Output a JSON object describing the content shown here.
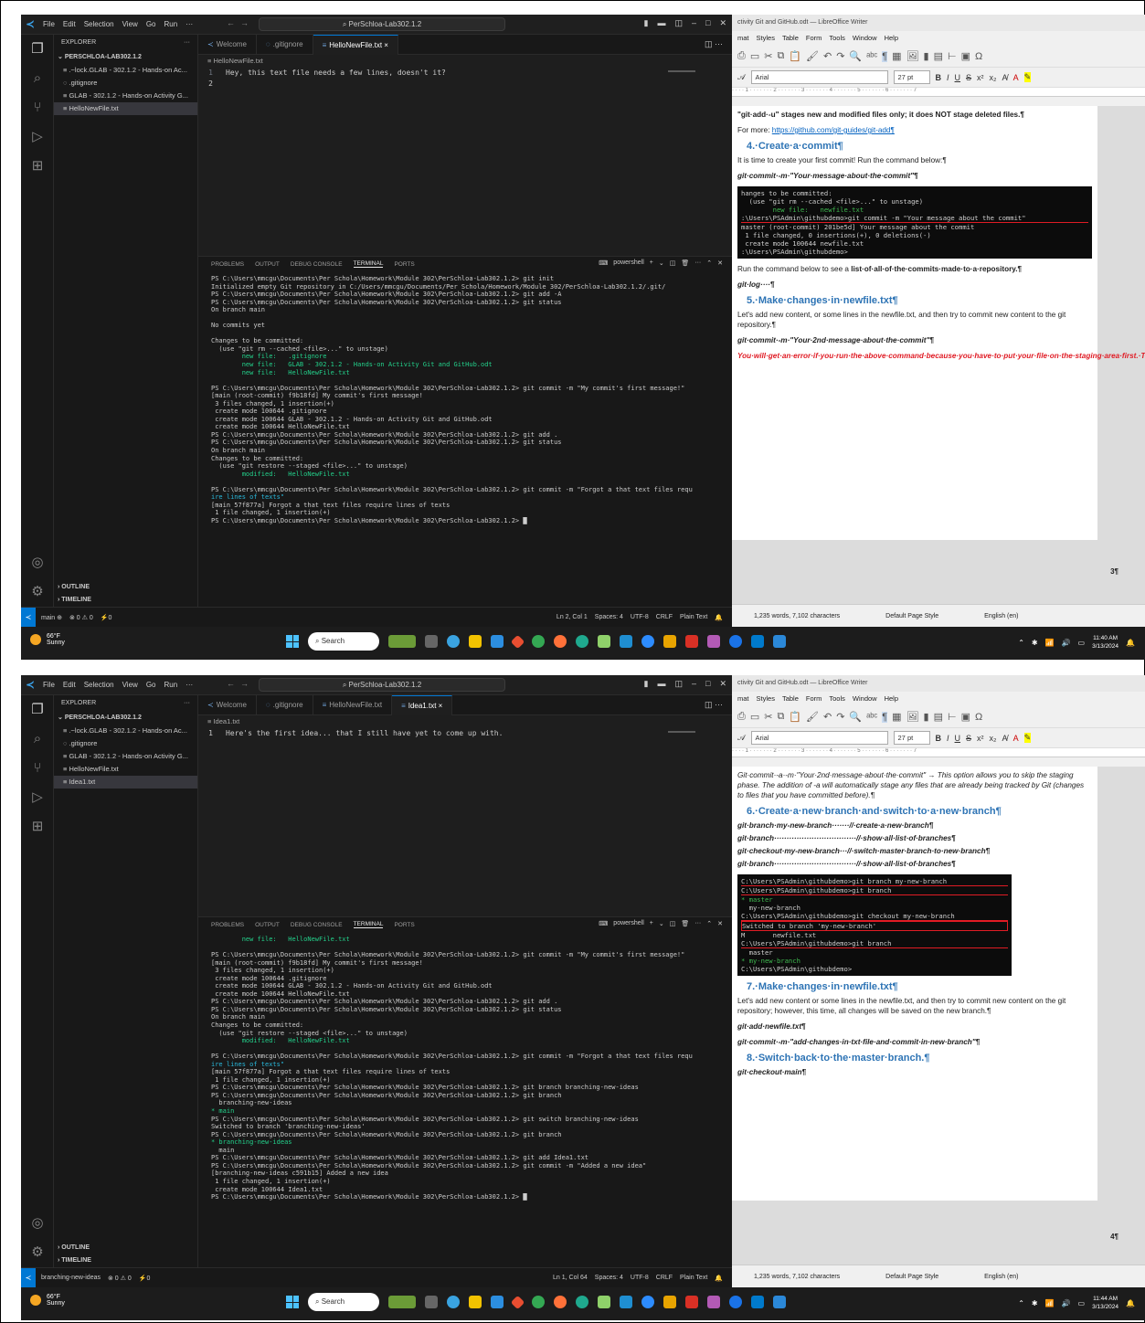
{
  "screens": [
    {
      "vscode": {
        "menu": [
          "File",
          "Edit",
          "Selection",
          "View",
          "Go",
          "Run",
          "···"
        ],
        "command_center": "PerSchloa-Lab302.1.2",
        "explorer_label": "EXPLORER",
        "root_folder": "PERSCHLOA-LAB302.1.2",
        "files": [
          ".~lock.GLAB - 302.1.2 - Hands-on Ac...",
          ".gitignore",
          "GLAB - 302.1.2 - Hands-on Activity G...",
          "HelloNewFile.txt"
        ],
        "selected_file_index": 3,
        "tabs": [
          {
            "label": "Welcome",
            "icon": "vscode-icon"
          },
          {
            "label": ".gitignore",
            "icon": "gear-icon"
          },
          {
            "label": "HelloNewFile.txt ×",
            "icon": "text-file-icon"
          }
        ],
        "active_tab_index": 2,
        "breadcrumb": "HelloNewFile.txt",
        "editor_lines": [
          "Hey, this text file needs a few lines, doesn't it?",
          ""
        ],
        "panel_tabs": [
          "PROBLEMS",
          "OUTPUT",
          "DEBUG CONSOLE",
          "TERMINAL",
          "PORTS"
        ],
        "terminal_name": "powershell",
        "terminal_lines": [
          {
            "t": "PS C:\\Users\\mmcgu\\Documents\\Per Schola\\Homework\\Module 302\\PerSchloa-Lab302.1.2> git init",
            "s": ""
          },
          {
            "t": "Initialized empty Git repository in C:/Users/mmcgu/Documents/Per Schola/Homework/Module 302/PerSchloa-Lab302.1.2/.git/",
            "s": ""
          },
          {
            "t": "PS C:\\Users\\mmcgu\\Documents\\Per Schola\\Homework\\Module 302\\PerSchloa-Lab302.1.2> git add -A",
            "s": ""
          },
          {
            "t": "PS C:\\Users\\mmcgu\\Documents\\Per Schola\\Homework\\Module 302\\PerSchloa-Lab302.1.2> git status",
            "s": ""
          },
          {
            "t": "On branch main",
            "s": ""
          },
          {
            "t": "",
            "s": ""
          },
          {
            "t": "No commits yet",
            "s": ""
          },
          {
            "t": "",
            "s": ""
          },
          {
            "t": "Changes to be committed:",
            "s": ""
          },
          {
            "t": "  (use \"git rm --cached <file>...\" to unstage)",
            "s": ""
          },
          {
            "t": "        new file:   .gitignore",
            "s": "g"
          },
          {
            "t": "        new file:   GLAB - 302.1.2 - Hands-on Activity Git and GitHub.odt",
            "s": "g"
          },
          {
            "t": "        new file:   HelloNewFile.txt",
            "s": "g"
          },
          {
            "t": "",
            "s": ""
          },
          {
            "t": "PS C:\\Users\\mmcgu\\Documents\\Per Schola\\Homework\\Module 302\\PerSchloa-Lab302.1.2> git commit -m \"My commit's first message!\"",
            "s": ""
          },
          {
            "t": "[main (root-commit) f9b18fd] My commit's first message!",
            "s": ""
          },
          {
            "t": " 3 files changed, 1 insertion(+)",
            "s": ""
          },
          {
            "t": " create mode 100644 .gitignore",
            "s": ""
          },
          {
            "t": " create mode 100644 GLAB - 302.1.2 - Hands-on Activity Git and GitHub.odt",
            "s": ""
          },
          {
            "t": " create mode 100644 HelloNewFile.txt",
            "s": ""
          },
          {
            "t": "PS C:\\Users\\mmcgu\\Documents\\Per Schola\\Homework\\Module 302\\PerSchloa-Lab302.1.2> git add .",
            "s": ""
          },
          {
            "t": "PS C:\\Users\\mmcgu\\Documents\\Per Schola\\Homework\\Module 302\\PerSchloa-Lab302.1.2> git status",
            "s": ""
          },
          {
            "t": "On branch main",
            "s": ""
          },
          {
            "t": "Changes to be committed:",
            "s": ""
          },
          {
            "t": "  (use \"git restore --staged <file>...\" to unstage)",
            "s": ""
          },
          {
            "t": "        modified:   HelloNewFile.txt",
            "s": "g"
          },
          {
            "t": "",
            "s": ""
          },
          {
            "t": "PS C:\\Users\\mmcgu\\Documents\\Per Schola\\Homework\\Module 302\\PerSchloa-Lab302.1.2> git commit -m \"Forgot a that text files requ",
            "s": ""
          },
          {
            "t": "ire lines of texts\"",
            "s": "c"
          },
          {
            "t": "[main 57f877a] Forgot a that text files require lines of texts",
            "s": ""
          },
          {
            "t": " 1 file changed, 1 insertion(+)",
            "s": ""
          },
          {
            "t": "PS C:\\Users\\mmcgu\\Documents\\Per Schola\\Homework\\Module 302\\PerSchloa-Lab302.1.2> █",
            "s": ""
          }
        ],
        "outline": "OUTLINE",
        "timeline": "TIMELINE",
        "status_left": [
          "main ⊕",
          "⊗ 0 ⚠ 0",
          "⚡0"
        ],
        "status_right": [
          "Ln 2, Col 1",
          "Spaces: 4",
          "UTF-8",
          "CRLF",
          "Plain Text"
        ]
      },
      "writer": {
        "title": "ctivity Git and GitHub.odt — LibreOffice Writer",
        "menu": [
          "mat",
          "Styles",
          "Table",
          "Form",
          "Tools",
          "Window",
          "Help"
        ],
        "font": "Arial",
        "size": "27 pt",
        "page_number": "3¶",
        "status": [
          "1,235 words, 7,102 characters",
          "Default Page Style",
          "English (en)"
        ]
      },
      "taskbar": {
        "temp": "66°F",
        "weather": "Sunny",
        "search": "Search",
        "time": "11:40 AM",
        "date": "3/13/2024"
      }
    },
    {
      "vscode": {
        "menu": [
          "File",
          "Edit",
          "Selection",
          "View",
          "Go",
          "Run",
          "···"
        ],
        "command_center": "PerSchloa-Lab302.1.2",
        "explorer_label": "EXPLORER",
        "root_folder": "PERSCHLOA-LAB302.1.2",
        "files": [
          ".~lock.GLAB - 302.1.2 - Hands-on Ac...",
          ".gitignore",
          "GLAB - 302.1.2 - Hands-on Activity G...",
          "HelloNewFile.txt",
          "Idea1.txt"
        ],
        "selected_file_index": 4,
        "tabs": [
          {
            "label": "Welcome",
            "icon": "vscode-icon"
          },
          {
            "label": ".gitignore",
            "icon": "gear-icon"
          },
          {
            "label": "HelloNewFile.txt",
            "icon": "text-file-icon"
          },
          {
            "label": "Idea1.txt ×",
            "icon": "text-file-icon"
          }
        ],
        "active_tab_index": 3,
        "breadcrumb": "Idea1.txt",
        "editor_lines": [
          "Here's the first idea... that I still have yet to come up with."
        ],
        "panel_tabs": [
          "PROBLEMS",
          "OUTPUT",
          "DEBUG CONSOLE",
          "TERMINAL",
          "PORTS"
        ],
        "terminal_name": "powershell",
        "terminal_lines": [
          {
            "t": "        new file:   HelloNewFile.txt",
            "s": "g"
          },
          {
            "t": "",
            "s": ""
          },
          {
            "t": "PS C:\\Users\\mmcgu\\Documents\\Per Schola\\Homework\\Module 302\\PerSchloa-Lab302.1.2> git commit -m \"My commit's first message!\"",
            "s": ""
          },
          {
            "t": "[main (root-commit) f9b18fd] My commit's first message!",
            "s": ""
          },
          {
            "t": " 3 files changed, 1 insertion(+)",
            "s": ""
          },
          {
            "t": " create mode 100644 .gitignore",
            "s": ""
          },
          {
            "t": " create mode 100644 GLAB - 302.1.2 - Hands-on Activity Git and GitHub.odt",
            "s": ""
          },
          {
            "t": " create mode 100644 HelloNewFile.txt",
            "s": ""
          },
          {
            "t": "PS C:\\Users\\mmcgu\\Documents\\Per Schola\\Homework\\Module 302\\PerSchloa-Lab302.1.2> git add .",
            "s": ""
          },
          {
            "t": "PS C:\\Users\\mmcgu\\Documents\\Per Schola\\Homework\\Module 302\\PerSchloa-Lab302.1.2> git status",
            "s": ""
          },
          {
            "t": "On branch main",
            "s": ""
          },
          {
            "t": "Changes to be committed:",
            "s": ""
          },
          {
            "t": "  (use \"git restore --staged <file>...\" to unstage)",
            "s": ""
          },
          {
            "t": "        modified:   HelloNewFile.txt",
            "s": "g"
          },
          {
            "t": "",
            "s": ""
          },
          {
            "t": "PS C:\\Users\\mmcgu\\Documents\\Per Schola\\Homework\\Module 302\\PerSchloa-Lab302.1.2> git commit -m \"Forgot a that text files requ",
            "s": ""
          },
          {
            "t": "ire lines of texts\"",
            "s": "c"
          },
          {
            "t": "[main 57f877a] Forgot a that text files require lines of texts",
            "s": ""
          },
          {
            "t": " 1 file changed, 1 insertion(+)",
            "s": ""
          },
          {
            "t": "PS C:\\Users\\mmcgu\\Documents\\Per Schola\\Homework\\Module 302\\PerSchloa-Lab302.1.2> git branch branching-new-ideas",
            "s": ""
          },
          {
            "t": "PS C:\\Users\\mmcgu\\Documents\\Per Schola\\Homework\\Module 302\\PerSchloa-Lab302.1.2> git branch",
            "s": ""
          },
          {
            "t": "  branching-new-ideas",
            "s": ""
          },
          {
            "t": "* main",
            "s": "g"
          },
          {
            "t": "PS C:\\Users\\mmcgu\\Documents\\Per Schola\\Homework\\Module 302\\PerSchloa-Lab302.1.2> git switch branching-new-ideas",
            "s": ""
          },
          {
            "t": "Switched to branch 'branching-new-ideas'",
            "s": ""
          },
          {
            "t": "PS C:\\Users\\mmcgu\\Documents\\Per Schola\\Homework\\Module 302\\PerSchloa-Lab302.1.2> git branch",
            "s": ""
          },
          {
            "t": "* branching-new-ideas",
            "s": "g"
          },
          {
            "t": "  main",
            "s": ""
          },
          {
            "t": "PS C:\\Users\\mmcgu\\Documents\\Per Schola\\Homework\\Module 302\\PerSchloa-Lab302.1.2> git add Idea1.txt",
            "s": ""
          },
          {
            "t": "PS C:\\Users\\mmcgu\\Documents\\Per Schola\\Homework\\Module 302\\PerSchloa-Lab302.1.2> git commit -m \"Added a new idea\"",
            "s": ""
          },
          {
            "t": "[branching-new-ideas c591b15] Added a new idea",
            "s": ""
          },
          {
            "t": " 1 file changed, 1 insertion(+)",
            "s": ""
          },
          {
            "t": " create mode 100644 Idea1.txt",
            "s": ""
          },
          {
            "t": "PS C:\\Users\\mmcgu\\Documents\\Per Schola\\Homework\\Module 302\\PerSchloa-Lab302.1.2> █",
            "s": ""
          }
        ],
        "outline": "OUTLINE",
        "timeline": "TIMELINE",
        "status_left": [
          "branching-new-ideas",
          "⊗ 0 ⚠ 0",
          "⚡0"
        ],
        "status_right": [
          "Ln 1, Col 64",
          "Spaces: 4",
          "UTF-8",
          "CRLF",
          "Plain Text"
        ]
      },
      "writer": {
        "title": "ctivity Git and GitHub.odt — LibreOffice Writer",
        "menu": [
          "mat",
          "Styles",
          "Table",
          "Form",
          "Tools",
          "Window",
          "Help"
        ],
        "font": "Arial",
        "size": "27 pt",
        "page_number": "4¶",
        "status": [
          "1,235 words, 7,102 characters",
          "Default Page Style",
          "English (en)"
        ]
      },
      "taskbar": {
        "temp": "66°F",
        "weather": "Sunny",
        "search": "Search",
        "time": "11:44 AM",
        "date": "3/13/2024"
      }
    }
  ],
  "doc1": {
    "p1": "\"git·add·-u\" stages new and modified files only; it does NOT stage deleted files.¶",
    "p2a": "For more: ",
    "p2b": "https://github.com/git-guides/git-add¶",
    "h4": "4.·Create·a·commit¶",
    "p3": "It is time to create your first commit! Run the command below:¶",
    "p4": "git·commit·-m·\"Your·message·about·the·commit\"¶",
    "cmd": [
      "hanges to be committed:",
      "  (use \"git rm --cached <file>...\" to unstage)",
      "",
      "        new file:   newfile.txt",
      "",
      "",
      ":\\Users\\PSAdmin\\githubdemo>git commit -m \"Your message about the commit\"",
      "master (root-commit) 201be5d] Your message about the commit",
      " 1 file changed, 0 insertions(+), 0 deletions(-)",
      " create mode 100644 newfile.txt",
      "",
      ":\\Users\\PSAdmin\\githubdemo>"
    ],
    "p5a": "Run the command below to see a ",
    "p5b": "list·of·all·of·the·commits·made·to·a·repository.¶",
    "p6": "git·log····¶",
    "h5": "5.·Make·changes·in·newfile.txt¶",
    "p7": "Let's add new content, or some lines in the newfile.txt, and then try to commit new content to the git repository.¶",
    "p8": "git·commit·-m·\"Your·2nd·message·about·the·commit\"¶",
    "p9": "You·will·get·an·error·if·you·run·the·above·command·because·you·have·to·put·your·file·on·the·staging·area·first.·Then·you·will·be·able·to·run·the·commit·command.·To·do·so,·run·the·below·commands:¶"
  },
  "doc2": {
    "p1a": "Git·commit·-a·-m·\"Your·2nd·message·about·the·commit\"",
    "p1b": " → This option allows you to skip the staging phase. The addition of -a will automatically stage any files that are already being tracked by Git (changes to files that you have committed before).¶",
    "h6": "6.·Create·a·new·branch·and·switch·to·a·new·branch¶",
    "c1": "git·branch·my-new-branch·······//·create·a·new·branch¶",
    "c2": "git·branch·································//·show·all·list·of·branches¶",
    "c3": "git·checkout·my-new-branch···//·switch·master·branch·to·new·branch¶",
    "c4": "git·branch·································//·show·all·list·of·branches¶",
    "cmd": [
      "C:\\Users\\PSAdmin\\githubdemo>git branch my-new-branch",
      "",
      "C:\\Users\\PSAdmin\\githubdemo>git branch",
      "* master",
      "  my-new-branch",
      "",
      "C:\\Users\\PSAdmin\\githubdemo>git checkout my-new-branch",
      "Switched to branch 'my-new-branch'",
      "M       newfile.txt",
      "",
      "C:\\Users\\PSAdmin\\githubdemo>git branch",
      "  master",
      "* my-new-branch",
      "",
      "C:\\Users\\PSAdmin\\githubdemo>"
    ],
    "h7": "7.·Make·changes·in·newfile.txt¶",
    "p2": "Let's add new content or some lines in the newfile.txt, and then try to commit new content on the git repository; however, this time, all changes will be saved on the new branch.¶",
    "p3": "git·add·newfile.txt¶",
    "p4": "git·commit·-m·\"add·changes·in·txt·file·and·commit·in·new·branch\"¶",
    "h8": "8.·Switch·back·to·the·master·branch.¶",
    "p5": "git·checkout·main¶"
  }
}
